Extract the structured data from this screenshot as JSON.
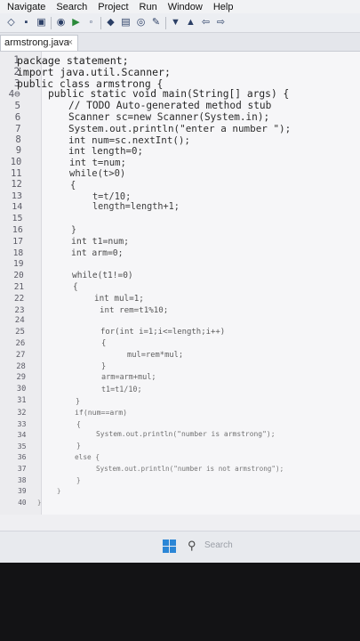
{
  "menu": [
    "Navigate",
    "Search",
    "Project",
    "Run",
    "Window",
    "Help"
  ],
  "tab": {
    "label": "armstrong.java",
    "close": "×"
  },
  "taskbar": {
    "search_label": "Search"
  },
  "code_lines": [
    {
      "n": "1",
      "text": "package statement;",
      "indent": 19
    },
    {
      "n": "2",
      "text": "import java.util.Scanner;",
      "indent": 19
    },
    {
      "n": "3",
      "text": "public class armstrong {",
      "indent": 19
    },
    {
      "n": "4⊖",
      "text": "public static void main(String[] args) {",
      "indent": 54
    },
    {
      "n": "5",
      "text": "// TODO Auto-generated method stub",
      "indent": 77
    },
    {
      "n": "6",
      "text": "Scanner sc=new Scanner(System.in);",
      "indent": 77
    },
    {
      "n": "7",
      "text": "System.out.println(\"enter a number \");",
      "indent": 77
    },
    {
      "n": "8",
      "text": "int num=sc.nextInt();",
      "indent": 77
    },
    {
      "n": "9",
      "text": "int length=0;",
      "indent": 77
    },
    {
      "n": "10",
      "text": "int t=num;",
      "indent": 78
    },
    {
      "n": "11",
      "text": "while(t>0)",
      "indent": 78
    },
    {
      "n": "12",
      "text": "{",
      "indent": 79
    },
    {
      "n": "13",
      "text": "t=t/10;",
      "indent": 104
    },
    {
      "n": "14",
      "text": "length=length+1;",
      "indent": 104
    },
    {
      "n": "15",
      "text": "",
      "indent": 104
    },
    {
      "n": "16",
      "text": "}",
      "indent": 80
    },
    {
      "n": "17",
      "text": "int t1=num;",
      "indent": 80
    },
    {
      "n": "18",
      "text": "int arm=0;",
      "indent": 80
    },
    {
      "n": "19",
      "text": "",
      "indent": 80
    },
    {
      "n": "20",
      "text": "while(t1!=0)",
      "indent": 81
    },
    {
      "n": "21",
      "text": "{",
      "indent": 82
    },
    {
      "n": "22",
      "text": "int mul=1;",
      "indent": 106
    },
    {
      "n": "23",
      "text": "int rem=t1%10;",
      "indent": 112
    },
    {
      "n": "24",
      "text": "",
      "indent": 112
    },
    {
      "n": "25",
      "text": "for(int i=1;i<=length;i++)",
      "indent": 113
    },
    {
      "n": "26",
      "text": "{",
      "indent": 114
    },
    {
      "n": "27",
      "text": "mul=rem*mul;",
      "indent": 143
    },
    {
      "n": "28",
      "text": "}",
      "indent": 114
    },
    {
      "n": "29",
      "text": "arm=arm+mul;",
      "indent": 114
    },
    {
      "n": "30",
      "text": "t1=t1/10;",
      "indent": 114
    },
    {
      "n": "31",
      "text": "}",
      "indent": 85
    },
    {
      "n": "32",
      "text": "if(num==arm)",
      "indent": 84
    },
    {
      "n": "33",
      "text": "{",
      "indent": 86
    },
    {
      "n": "34",
      "text": "System.out.println(\"number is armstrong\");",
      "indent": 108
    },
    {
      "n": "35",
      "text": "}",
      "indent": 86
    },
    {
      "n": "36",
      "text": "else {",
      "indent": 84
    },
    {
      "n": "37",
      "text": "System.out.println(\"number is not armstrong\");",
      "indent": 108
    },
    {
      "n": "38",
      "text": "}",
      "indent": 86
    },
    {
      "n": "39",
      "text": "}",
      "indent": 64
    },
    {
      "n": "40",
      "text": "}",
      "indent": 42
    }
  ]
}
